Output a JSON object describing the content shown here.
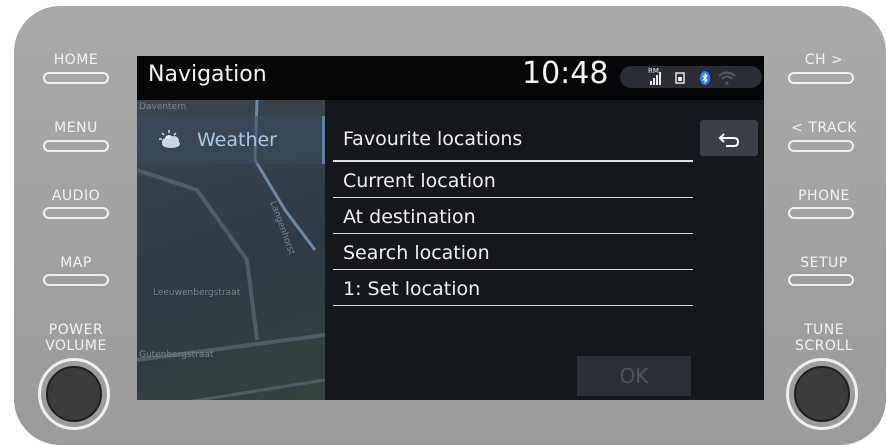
{
  "hardware": {
    "left_buttons": [
      "HOME",
      "MENU",
      "AUDIO",
      "MAP"
    ],
    "left_knob_label_line1": "POWER",
    "left_knob_label_line2": "VOLUME",
    "right_buttons": [
      "CH >",
      "< TRACK",
      "PHONE",
      "SETUP"
    ],
    "right_knob_label_line1": "TUNE",
    "right_knob_label_line2": "SCROLL"
  },
  "status": {
    "title": "Navigation",
    "clock": "10:48",
    "rm_label": "RM",
    "signal_icon": "signal-bars-icon",
    "battery_icon": "battery-icon",
    "bluetooth_icon": "bluetooth-icon",
    "wifi_icon": "wifi-icon"
  },
  "map": {
    "labels": [
      "Daventern",
      "Leeuwenbergstraat",
      "Gutenbergstraat",
      "Langenhorst"
    ]
  },
  "sidebar": {
    "weather_icon": "weather-sun-cloud-icon",
    "weather_label": "Weather"
  },
  "menu": {
    "header": "Favourite locations",
    "items": [
      "Current location",
      "At destination",
      "Search location",
      "1: Set location"
    ]
  },
  "buttons": {
    "back_glyph": "⮌",
    "ok_label": "OK"
  },
  "colors": {
    "accent": "#5d7ea6",
    "weather_text": "#a9c7e6",
    "bluetooth": "#2f7bff"
  }
}
